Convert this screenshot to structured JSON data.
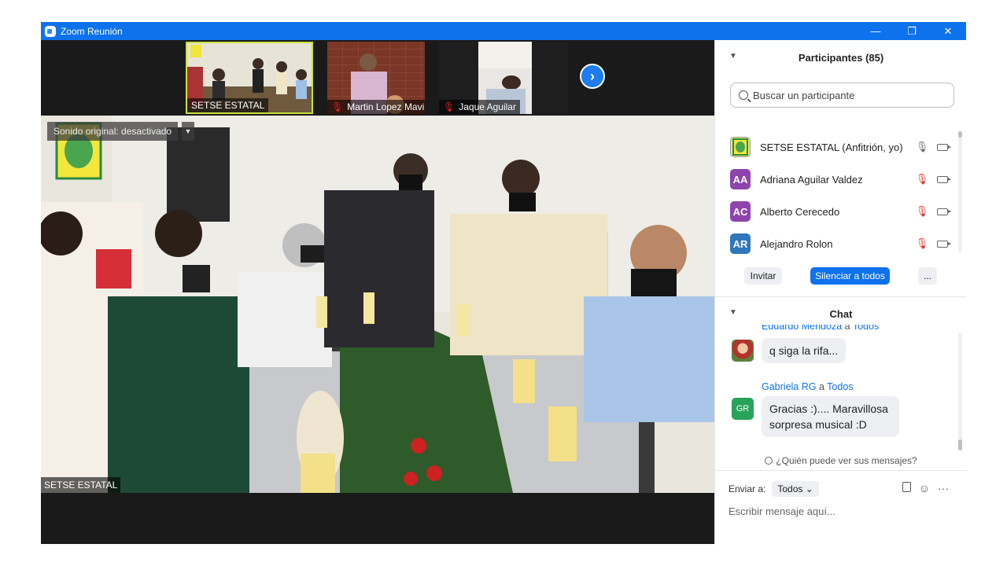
{
  "window": {
    "title": "Zoom Reunión",
    "controls": {
      "minimize": "—",
      "restore": "❐",
      "close": "✕"
    }
  },
  "thumbnails": [
    {
      "name": "SETSE ESTATAL",
      "muted": false
    },
    {
      "name": "Martin Lopez Mavil",
      "muted": true
    },
    {
      "name": "Jaque Aguilar",
      "muted": true
    }
  ],
  "main_video": {
    "sound_badge": "Sonido original: desactivado",
    "speaker_label": "SETSE ESTATAL"
  },
  "participants": {
    "header": "Participantes (85)",
    "search_placeholder": "Buscar un participante",
    "list": [
      {
        "name": "SETSE ESTATAL (Anfitrión, yo)",
        "initials": "",
        "color": "#c9d83a",
        "muted": false
      },
      {
        "name": "Adriana Aguilar Valdez",
        "initials": "AA",
        "color": "#8e44ad",
        "muted": true
      },
      {
        "name": "Alberto Cerecedo",
        "initials": "AC",
        "color": "#8e44ad",
        "muted": true
      },
      {
        "name": "Alejandro Rolon",
        "initials": "AR",
        "color": "#2e77bb",
        "muted": true
      }
    ],
    "buttons": {
      "invite": "Invitar",
      "mute_all": "Silenciar a todos",
      "more": "..."
    }
  },
  "chat": {
    "header": "Chat",
    "messages": [
      {
        "sender": "Eduardo Mendoza",
        "to_word": "a",
        "to": "Todos",
        "text": "q siga la rifa..."
      },
      {
        "sender": "Gabriela RG",
        "to_word": "a",
        "to": "Todos",
        "initials": "GR",
        "text": "Gracias :).... Maravillosa sorpresa musical :D"
      }
    ],
    "who_can_see": "¿Quién puede ver sus mensajes?",
    "send_to_label": "Enviar a:",
    "send_to_value": "Todos",
    "input_placeholder": "Escribir mensaje aquí..."
  },
  "colors": {
    "zoom_blue": "#0e72ed",
    "muted_red": "#e02828",
    "button_blue": "#0e72ed"
  }
}
